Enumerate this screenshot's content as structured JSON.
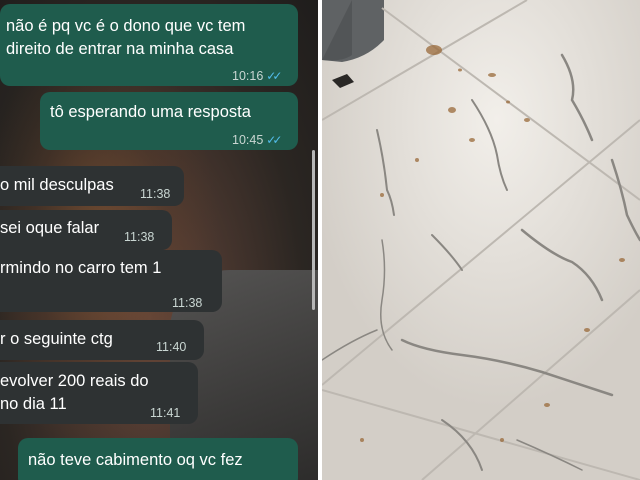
{
  "chat": {
    "messages": [
      {
        "text_line1": "não é pq vc é o dono que vc tem",
        "text_line2": "direito de entrar na minha casa",
        "time": "10:16"
      },
      {
        "text": "tô esperando uma resposta",
        "time": "10:45"
      },
      {
        "text": "o mil desculpas",
        "time": "11:38"
      },
      {
        "text": "sei oque falar",
        "time": "11:38"
      },
      {
        "text": "rmindo no carro tem 1",
        "time": "11:38"
      },
      {
        "text": "r o seguinte ctg",
        "time": "11:40"
      },
      {
        "text_line1": "evolver 200 reais  do",
        "text_line2": "no dia 11",
        "time": "11:41"
      },
      {
        "text": "não teve cabimento oq vc fez"
      }
    ],
    "colors": {
      "outgoing": "#1f5c4d",
      "incoming": "#2e3233",
      "read_ticks": "#53bdeb"
    },
    "icons": {
      "read_receipt": "double-check-icon"
    }
  },
  "photo": {
    "colors": {
      "tile": "#dcd8d2",
      "vein": "#8a8782",
      "stain": "#9a6a3a"
    }
  }
}
